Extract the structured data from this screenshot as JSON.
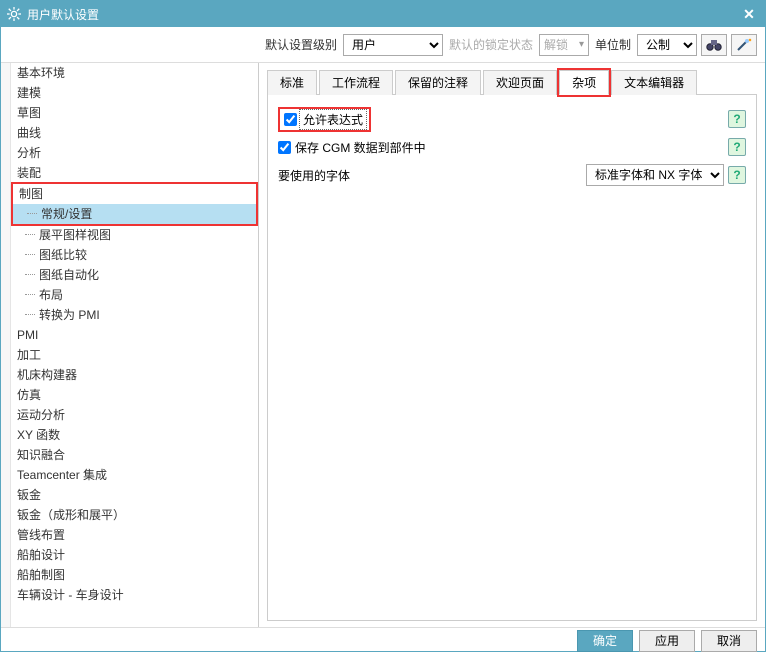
{
  "window": {
    "title": "用户默认设置"
  },
  "toolbar": {
    "level_label": "默认设置级别",
    "level_value": "用户",
    "lock_label": "默认的锁定状态",
    "lock_value": "解锁",
    "unit_label": "单位制",
    "unit_value": "公制"
  },
  "tree": {
    "items": [
      {
        "label": "基本环境",
        "lvl": 0
      },
      {
        "label": "建模",
        "lvl": 0
      },
      {
        "label": "草图",
        "lvl": 0
      },
      {
        "label": "曲线",
        "lvl": 0
      },
      {
        "label": "分析",
        "lvl": 0
      },
      {
        "label": "装配",
        "lvl": 0
      },
      {
        "label": "制图",
        "lvl": 0,
        "group_hl": true
      },
      {
        "label": "常规/设置",
        "lvl": 1,
        "selected": true,
        "group_hl": true
      },
      {
        "label": "展平图样视图",
        "lvl": 1
      },
      {
        "label": "图纸比较",
        "lvl": 1
      },
      {
        "label": "图纸自动化",
        "lvl": 1
      },
      {
        "label": "布局",
        "lvl": 1
      },
      {
        "label": "转换为 PMI",
        "lvl": 1
      },
      {
        "label": "PMI",
        "lvl": 0
      },
      {
        "label": "加工",
        "lvl": 0
      },
      {
        "label": "机床构建器",
        "lvl": 0
      },
      {
        "label": "仿真",
        "lvl": 0
      },
      {
        "label": "运动分析",
        "lvl": 0
      },
      {
        "label": "XY 函数",
        "lvl": 0
      },
      {
        "label": "知识融合",
        "lvl": 0
      },
      {
        "label": "Teamcenter 集成",
        "lvl": 0
      },
      {
        "label": "钣金",
        "lvl": 0
      },
      {
        "label": "钣金（成形和展平）",
        "lvl": 0
      },
      {
        "label": "管线布置",
        "lvl": 0
      },
      {
        "label": "船舶设计",
        "lvl": 0
      },
      {
        "label": "船舶制图",
        "lvl": 0
      },
      {
        "label": "车辆设计 - 车身设计",
        "lvl": 0
      }
    ]
  },
  "tabs": [
    {
      "label": "标准"
    },
    {
      "label": "工作流程"
    },
    {
      "label": "保留的注释"
    },
    {
      "label": "欢迎页面"
    },
    {
      "label": "杂项",
      "active": true,
      "hl": true
    },
    {
      "label": "文本编辑器"
    }
  ],
  "panel": {
    "row1": {
      "checked": true,
      "label": "允许表达式",
      "hl": true
    },
    "row2": {
      "checked": true,
      "label": "保存 CGM 数据到部件中"
    },
    "row3": {
      "label": "要使用的字体",
      "select_value": "标准字体和 NX 字体"
    }
  },
  "footer": {
    "ok": "确定",
    "apply": "应用",
    "cancel": "取消"
  }
}
